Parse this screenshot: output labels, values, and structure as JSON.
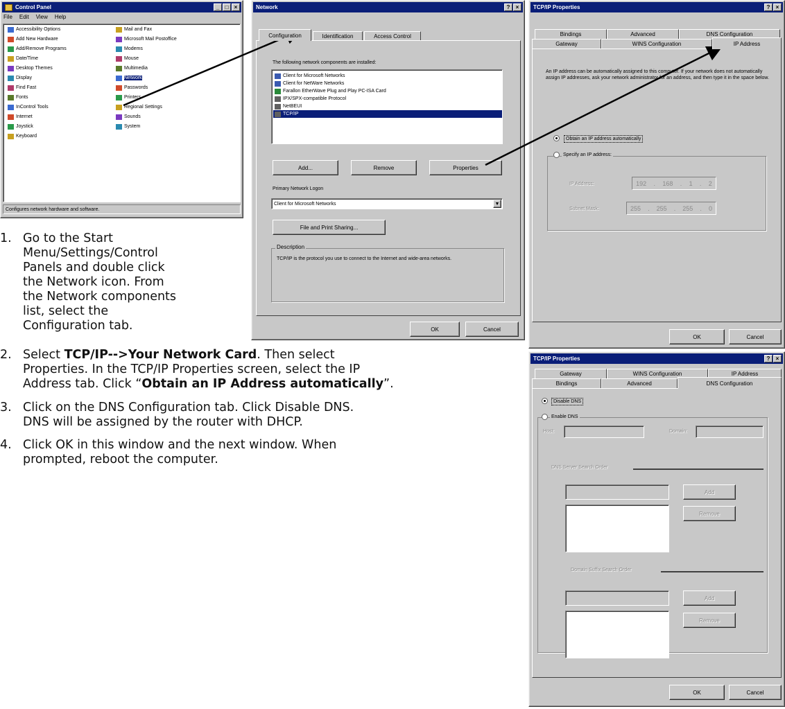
{
  "control_panel": {
    "title": "Control Panel",
    "menu": [
      "File",
      "Edit",
      "View",
      "Help"
    ],
    "col1": [
      "Accessibility Options",
      "Add New Hardware",
      "Add/Remove Programs",
      "Date/Time",
      "Desktop Themes",
      "Display",
      "Find Fast",
      "Fonts",
      "InControl Tools",
      "Internet",
      "Joystick",
      "Keyboard"
    ],
    "col2": [
      "Mail and Fax",
      "Microsoft Mail Postoffice",
      "Modems",
      "Mouse",
      "Multimedia",
      "Network",
      "Passwords",
      "Printers",
      "Regional Settings",
      "Sounds",
      "System"
    ],
    "status": "Configures network hardware and software."
  },
  "network": {
    "title": "Network",
    "tabs": [
      "Configuration",
      "Identification",
      "Access Control"
    ],
    "list_label": "The following network components are installed:",
    "components": [
      "Client for Microsoft Networks",
      "Client for NetWare Networks",
      "Farallon EtherWave Plug and Play PC-ISA Card",
      "IPX/SPX-compatible Protocol",
      "NetBEUI",
      "TCP/IP"
    ],
    "add_button": "Add...",
    "remove_button": "Remove",
    "properties_button": "Properties",
    "logon_label": "Primary Network Logon",
    "logon_value": "Client for Microsoft Networks",
    "file_print_button": "File and Print Sharing...",
    "description_label": "Description",
    "description_text": "TCP/IP is the protocol you use to connect to the Internet and wide-area networks.",
    "ok": "OK",
    "cancel": "Cancel"
  },
  "tcpip_ip": {
    "title": "TCP/IP Properties",
    "tabs_back": [
      "Bindings",
      "Advanced",
      "DNS Configuration"
    ],
    "tabs_front": [
      "Gateway",
      "WINS Configuration",
      "IP Address"
    ],
    "info": "An IP address can be automatically assigned to this computer. If your network does not automatically assign IP addresses, ask your network administrator for an address, and then type it in the space below.",
    "obtain_auto": "Obtain an IP address automatically",
    "specify": "Specify an IP address:",
    "ip_label": "IP Address:",
    "ip_value": [
      "192",
      "168",
      "1",
      "2"
    ],
    "mask_label": "Subnet Mask:",
    "mask_value": [
      "255",
      "255",
      "255",
      "0"
    ],
    "ok": "OK",
    "cancel": "Cancel"
  },
  "tcpip_dns": {
    "title": "TCP/IP Properties",
    "tabs_back": [
      "Gateway",
      "WINS Configuration",
      "IP Address"
    ],
    "tabs_front": [
      "Bindings",
      "Advanced",
      "DNS Configuration"
    ],
    "disable_dns": "Disable DNS",
    "enable_dns": "Enable DNS",
    "host_label": "Host:",
    "domain_label": "Domain:",
    "server_order": "DNS Server Search Order",
    "suffix_order": "Domain Suffix Search Order",
    "add": "Add",
    "remove": "Remove",
    "ok": "OK",
    "cancel": "Cancel"
  },
  "instructions": {
    "steps": [
      {
        "num": "1.",
        "lines": [
          "Go to the Start",
          "Menu/Settings/Control",
          "Panels and double click",
          "the Network icon. From",
          "the Network components",
          "list, select the",
          "Configuration tab."
        ]
      },
      {
        "num": "2.",
        "l1_a": "Select ",
        "l1_b": "TCP/IP-->Your Network Card",
        "l1_c": ". Then select",
        "l2": "Properties. In the TCP/IP Properties screen, select the IP",
        "l3_a": "Address tab. Click “",
        "l3_b": "Obtain an IP Address automatically",
        "l3_c": "”."
      },
      {
        "num": "3.",
        "lines": [
          "Click on the DNS Configuration tab. Click Disable DNS.",
          "DNS will be assigned by the router with DHCP."
        ]
      },
      {
        "num": "4.",
        "lines": [
          "Click OK in this window and the next window. When",
          "prompted, reboot the computer."
        ]
      }
    ]
  },
  "colors": {
    "titlebar": "#0a1e78",
    "face": "#c8c8c8",
    "selection": "#0a1e78"
  }
}
